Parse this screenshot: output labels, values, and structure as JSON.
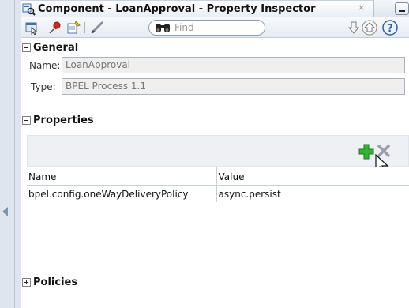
{
  "window": {
    "tab_title": "Component - LoanApproval - Property Inspector",
    "tab_close_glyph": "×",
    "tab_icon": "component-icon"
  },
  "toolbar": {
    "buttons": [
      "select-icon",
      "pin-icon",
      "edit-icon",
      "pencil-icon",
      "binoculars-icon",
      "arrow-down-icon",
      "arrow-up-icon",
      "help-icon"
    ],
    "search_placeholder": "Find"
  },
  "general": {
    "title": "General",
    "name_label": "Name:",
    "name_value": "LoanApproval",
    "type_label": "Type:",
    "type_value": "BPEL Process 1.1"
  },
  "properties": {
    "title": "Properties",
    "columns": [
      "Name",
      "Value"
    ],
    "rows": [
      {
        "name": "bpel.config.oneWayDeliveryPolicy",
        "value": "async.persist"
      }
    ],
    "add_icon": "add-icon",
    "remove_icon": "remove-icon"
  },
  "policies": {
    "title": "Policies"
  },
  "colors": {
    "accent_green": "#2fa52f",
    "header_bg": "#dfe6ef",
    "field_bg": "#efefef"
  }
}
